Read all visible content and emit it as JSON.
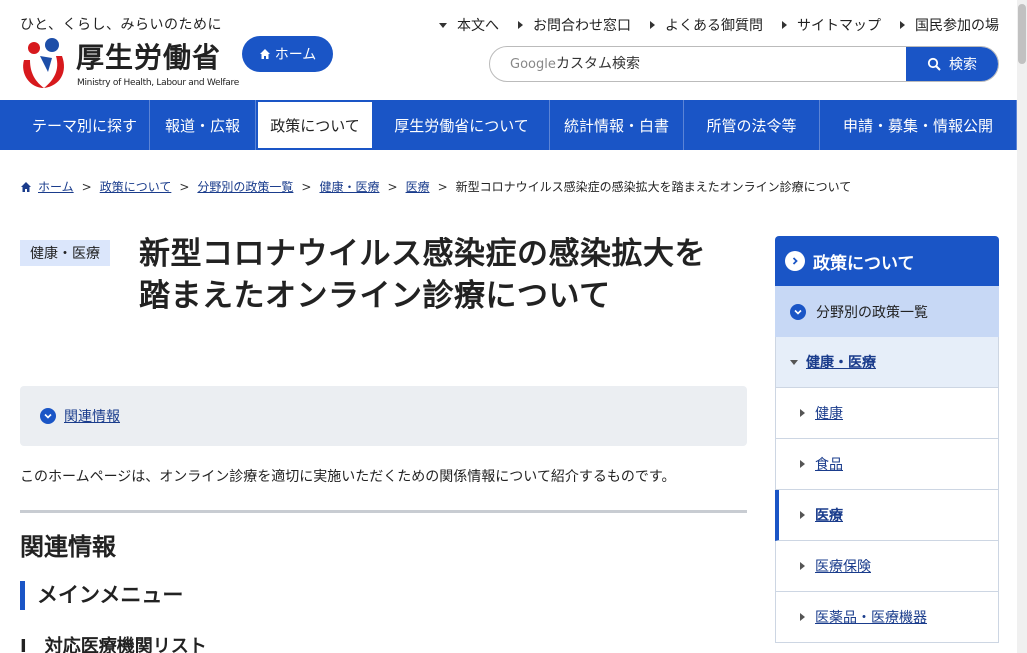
{
  "header": {
    "tagline": "ひと、くらし、みらいのために",
    "logo_name": "厚生労働省",
    "logo_en": "Ministry of Health, Labour and Welfare",
    "home_button": "ホーム",
    "util_links": [
      {
        "label": "本文へ",
        "arrow": "down"
      },
      {
        "label": "お問合わせ窓口",
        "arrow": "right"
      },
      {
        "label": "よくある御質問",
        "arrow": "right"
      },
      {
        "label": "サイトマップ",
        "arrow": "right"
      },
      {
        "label": "国民参加の場",
        "arrow": "right"
      }
    ],
    "search": {
      "brand": "Google",
      "placeholder": "カスタム検索",
      "button": "検索"
    }
  },
  "gnav": [
    {
      "label": "テーマ別に探す",
      "active": false
    },
    {
      "label": "報道・広報",
      "active": false
    },
    {
      "label": "政策について",
      "active": true
    },
    {
      "label": "厚生労働省について",
      "active": false
    },
    {
      "label": "統計情報・白書",
      "active": false
    },
    {
      "label": "所管の法令等",
      "active": false
    },
    {
      "label": "申請・募集・情報公開",
      "active": false
    }
  ],
  "breadcrumb": {
    "links": [
      "ホーム",
      "政策について",
      "分野別の政策一覧",
      "健康・医療",
      "医療"
    ],
    "current": "新型コロナウイルス感染症の感染拡大を踏まえたオンライン診療について"
  },
  "main": {
    "category": "健康・医療",
    "title": "新型コロナウイルス感染症の感染拡大を踏まえたオンライン診療について",
    "toc_link": "関連情報",
    "intro": "このホームページは、オンライン診療を適切に実施いただくための関係情報について紹介するものです。",
    "h2": "関連情報",
    "h3": "メインメニュー",
    "h4": "Ⅰ　対応医療機関リスト"
  },
  "side": {
    "head": "政策について",
    "level1": "分野別の政策一覧",
    "level2": "健康・医療",
    "items": [
      {
        "label": "健康",
        "active": false
      },
      {
        "label": "食品",
        "active": false
      },
      {
        "label": "医療",
        "active": true
      },
      {
        "label": "医療保険",
        "active": false
      },
      {
        "label": "医薬品・医療機器",
        "active": false
      }
    ]
  },
  "colors": {
    "brand_blue": "#1a55c6",
    "tag_bg": "#dbe6fb",
    "logo_red": "#d7191d",
    "logo_blue": "#1d4ea8"
  }
}
